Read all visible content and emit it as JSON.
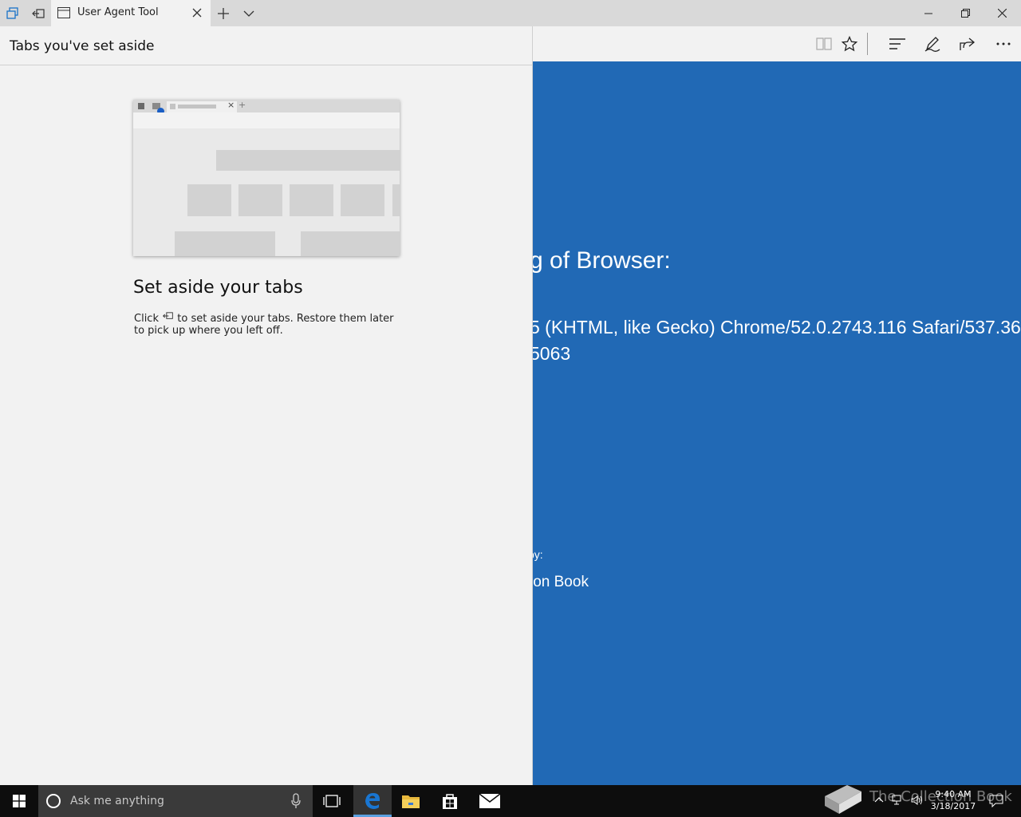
{
  "window": {
    "tab_title": "User Agent Tool"
  },
  "panel": {
    "title": "Tabs you've set aside",
    "heading": "Set aside your tabs",
    "desc_before": "Click",
    "desc_after": "to set aside your tabs. Restore them later to pick up where you left off."
  },
  "page": {
    "line1": "g of Browser:",
    "line2": "5 (KHTML, like Gecko) Chrome/52.0.2743.116 Safari/537.36",
    "line3": "5063",
    "line4": "by:",
    "line5": "ion Book"
  },
  "taskbar": {
    "search_placeholder": "Ask me anything",
    "time": "9:40 AM",
    "date": "3/18/2017",
    "watermark": "The Collection Book"
  },
  "colors": {
    "page_background": "#2169b5",
    "edge_blue": "#1976d2"
  }
}
